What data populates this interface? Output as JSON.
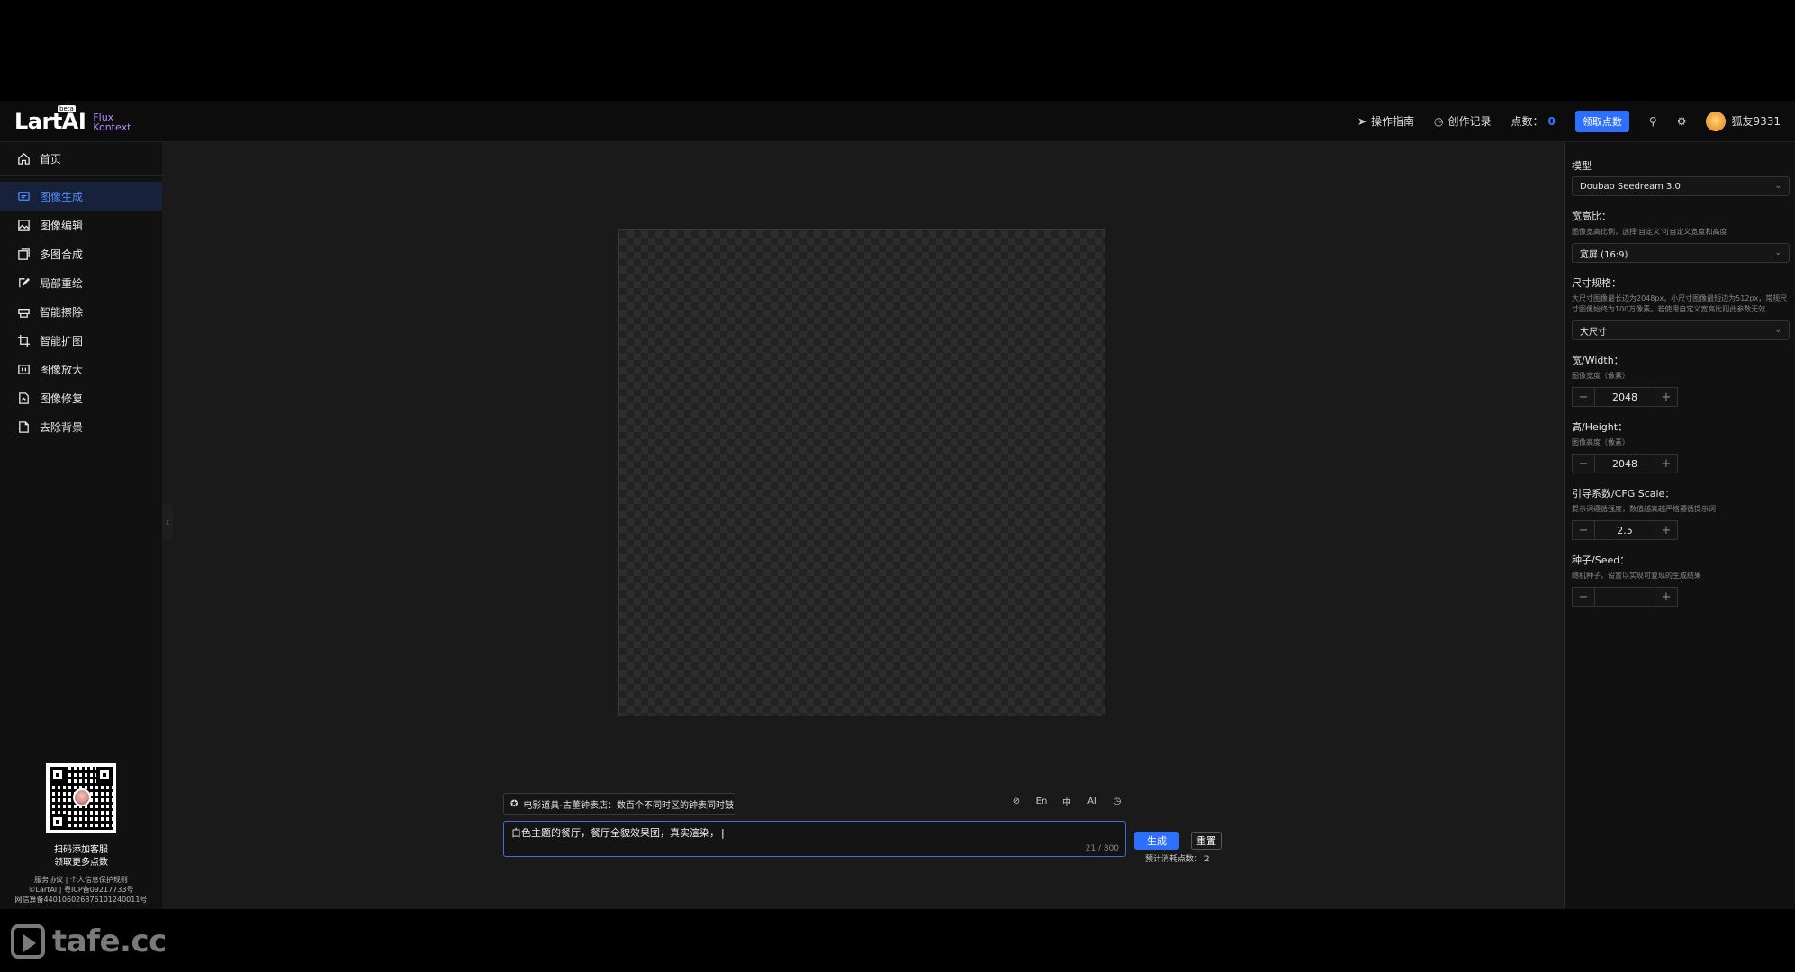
{
  "header": {
    "logo": "LartAI",
    "beta": "beta",
    "logo_sub1": "Flux",
    "logo_sub2": "Kontext",
    "guide": "操作指南",
    "history": "创作记录",
    "points_label": "点数：",
    "points_value": "0",
    "claim": "领取点数",
    "username": "狐友9331"
  },
  "sidebar": {
    "home": "首页",
    "items": [
      {
        "label": "图像生成",
        "icon": "chat-icon"
      },
      {
        "label": "图像编辑",
        "icon": "image-icon"
      },
      {
        "label": "多图合成",
        "icon": "layers-icon"
      },
      {
        "label": "局部重绘",
        "icon": "edit-icon"
      },
      {
        "label": "智能擦除",
        "icon": "eraser-icon"
      },
      {
        "label": "智能扩图",
        "icon": "crop-icon"
      },
      {
        "label": "图像放大",
        "icon": "expand-icon"
      },
      {
        "label": "图像修复",
        "icon": "repair-icon"
      },
      {
        "label": "去除背景",
        "icon": "file-icon"
      }
    ],
    "qr_line1": "扫码添加客服",
    "qr_line2": "领取更多点数",
    "legal1": "服务协议 | 个人信息保护规则",
    "legal2": "©LartAI | 粤ICP备09217733号",
    "legal3": "网信算备440106026876101240011号"
  },
  "prompt": {
    "suggestion": "电影道具-古董钟表店：数百个不同时区的钟表同时鼓...",
    "tools": [
      "⊘",
      "En",
      "中",
      "AI",
      "◷"
    ],
    "text": "白色主题的餐厅，餐厅全貌效果图，真实渲染，",
    "counter": "21 / 800",
    "generate": "生成",
    "reset": "重置",
    "cost_label": "预计消耗点数：",
    "cost_value": "2"
  },
  "panel": {
    "model_label": "模型",
    "model_value": "Doubao Seedream 3.0",
    "ratio_label": "宽高比：",
    "ratio_desc": "图像宽高比例，选择'自定义'可自定义宽度和高度",
    "ratio_value": "宽屏 (16:9)",
    "size_label": "尺寸规格：",
    "size_desc": "大尺寸图像最长边为2048px，小尺寸图像最短边为512px，常规尺寸图像始终为100万像素。若使用自定义宽高比则此参数无效",
    "size_value": "大尺寸",
    "width_label": "宽/Width：",
    "width_desc": "图像宽度（像素）",
    "width_value": "2048",
    "height_label": "高/Height：",
    "height_desc": "图像高度（像素）",
    "height_value": "2048",
    "cfg_label": "引导系数/CFG Scale：",
    "cfg_desc": "提示词遵循强度，数值越高越严格遵循提示词",
    "cfg_value": "2.5",
    "seed_label": "种子/Seed：",
    "seed_desc": "随机种子，设置以实现可复现的生成结果",
    "seed_value": ""
  },
  "watermark": "tafe.cc"
}
